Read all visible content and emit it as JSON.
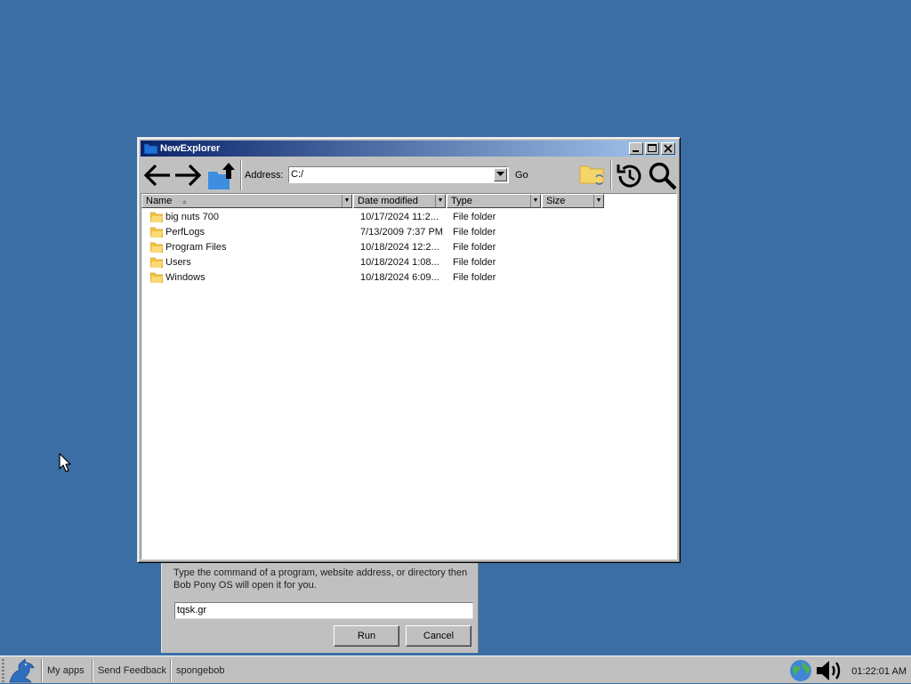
{
  "run_dialog": {
    "description_line1": "Type the command of a program, website address, or directory then",
    "description_line2": "Bob Pony OS will open it for you.",
    "input_value": "tqsk.gr",
    "run_label": "Run",
    "cancel_label": "Cancel"
  },
  "explorer": {
    "title": "NewExplorer",
    "address_label": "Address:",
    "address_value": "C:/",
    "go_label": "Go",
    "columns": [
      "Name",
      "Date modified",
      "Type",
      "Size"
    ],
    "rows": [
      {
        "name": "big nuts 700",
        "date": "10/17/2024 11:2...",
        "type": "File folder",
        "size": ""
      },
      {
        "name": "PerfLogs",
        "date": "7/13/2009 7:37 PM",
        "type": "File folder",
        "size": ""
      },
      {
        "name": "Program Files",
        "date": "10/18/2024 12:2...",
        "type": "File folder",
        "size": ""
      },
      {
        "name": "Users",
        "date": "10/18/2024 1:08...",
        "type": "File folder",
        "size": ""
      },
      {
        "name": "Windows",
        "date": "10/18/2024 6:09...",
        "type": "File folder",
        "size": ""
      }
    ]
  },
  "taskbar": {
    "items": [
      "My apps",
      "Send Feedback",
      "spongebob"
    ],
    "clock": "01:22:01 AM"
  },
  "icons": {
    "back": "arrow-left-icon",
    "forward": "arrow-right-icon",
    "up": "folder-up-icon",
    "folder_sync": "folder-sync-icon",
    "history": "history-icon",
    "search": "search-icon",
    "start": "bird-logo-icon",
    "network": "globe-icon",
    "volume": "speaker-icon"
  },
  "colors": {
    "desktop": "#3a6ea5",
    "titlebar_start": "#0a246a",
    "titlebar_end": "#a6caf0",
    "folder": "#f5c542"
  }
}
